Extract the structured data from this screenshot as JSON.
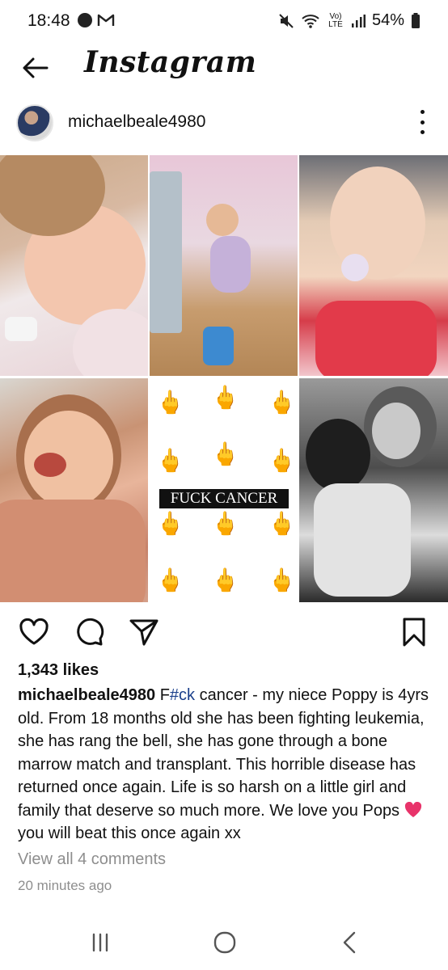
{
  "status_bar": {
    "time": "18:48",
    "battery": "54%",
    "network": "Vo) LTE"
  },
  "header": {
    "title": "Instagram"
  },
  "post": {
    "username": "michaelbeale4980",
    "image_text": "FUCK CANCER",
    "likes": "1,343 likes",
    "caption_user": "michaelbeale4980",
    "caption_before_tag": "F",
    "caption_tag": "#ck",
    "caption_part1": " cancer - my niece Poppy is 4yrs old. From 18 months old she has been fighting leukemia, she has rang the bell, she has gone through a bone marrow match and transplant. This horrible disease has returned once again. Life is so harsh on a little girl and family that deserve so much more. We love you Pops ",
    "caption_part2": " you will beat this once again xx",
    "comments_link": "View all 4 comments",
    "time_ago": "20 minutes ago"
  },
  "icons": {
    "back": "arrow-left-icon",
    "more": "more-vertical-icon",
    "like": "heart-icon",
    "comment": "comment-icon",
    "share": "send-icon",
    "save": "bookmark-icon",
    "nav_recents": "recents-icon",
    "nav_home": "home-icon",
    "nav_back": "back-chevron-icon"
  },
  "colors": {
    "hashtag": "#1a3f8b",
    "muted": "#8e8e8e",
    "heart_emoji": "#e8336a"
  }
}
